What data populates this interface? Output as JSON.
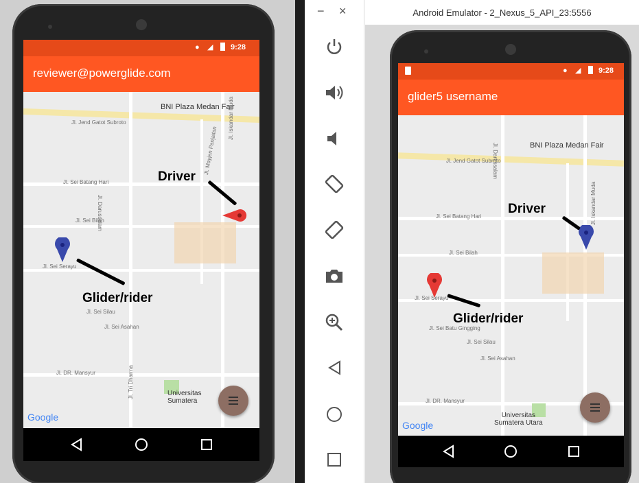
{
  "left": {
    "status": {
      "time": "9:28"
    },
    "appbar": {
      "title": "reviewer@powerglide.com"
    },
    "map": {
      "poi_plaza": "BNI Plaza Medan Fair",
      "poi_univ_1": "Universitas",
      "poi_univ_2": "Sumatera",
      "street_batang_hari": "Jl. Sei Batang Hari",
      "street_bilah": "Jl. Sei Bilah",
      "street_serayu": "Jl. Sei Serayu",
      "street_silau": "Jl. Sei Silau",
      "street_asahan": "Jl. Sei Asahan",
      "street_mansyur": "Jl. DR. Mansyur",
      "street_jend_gatot": "Jl. Jend Gatot Subroto",
      "street_darussalam": "Jl. Darussalam",
      "street_iskandar": "Jl. Iskandar Muda",
      "street_mayjen": "Jl. Mayjen Panjaitan",
      "street_tri_dharma": "Jl. Tri Dharma",
      "label_driver": "Driver",
      "label_rider": "Glider/rider",
      "google": "Google"
    }
  },
  "toolbar": {
    "minimize": "−",
    "close": "×",
    "items": [
      "power-icon",
      "volume-up-icon",
      "volume-down-icon",
      "rotate-left-icon",
      "rotate-right-icon",
      "camera-icon",
      "zoom-icon",
      "back-icon",
      "home-icon",
      "overview-icon"
    ]
  },
  "right": {
    "window_title": "Android Emulator - 2_Nexus_5_API_23:5556",
    "status": {
      "time": "9:28"
    },
    "appbar": {
      "title": "glider5 username"
    },
    "map": {
      "poi_plaza": "BNI Plaza Medan Fair",
      "poi_univ_1": "Universitas",
      "poi_univ_2": "Sumatera Utara",
      "street_batang_hari": "Jl. Sei Batang Hari",
      "street_bilah": "Jl. Sei Bilah",
      "street_serayu": "Jl. Sei Serayu",
      "street_batu_ginging": "Jl. Sei Batu Gingging",
      "street_silau": "Jl. Sei Silau",
      "street_asahan": "Jl. Sei Asahan",
      "street_mansyur": "Jl. DR. Mansyur",
      "street_jend_gatot": "Jl. Jend Gatot Subroto",
      "street_darussalam": "Jl. Darussalam",
      "street_iskandar": "Jl. Iskandar Muda",
      "label_driver": "Driver",
      "label_rider": "Glider/rider",
      "google": "Google"
    }
  },
  "colors": {
    "status": "#e64a19",
    "appbar": "#ff5722",
    "pin_red": "#e53935",
    "pin_blue": "#3949ab",
    "fab": "#8d6e63"
  }
}
